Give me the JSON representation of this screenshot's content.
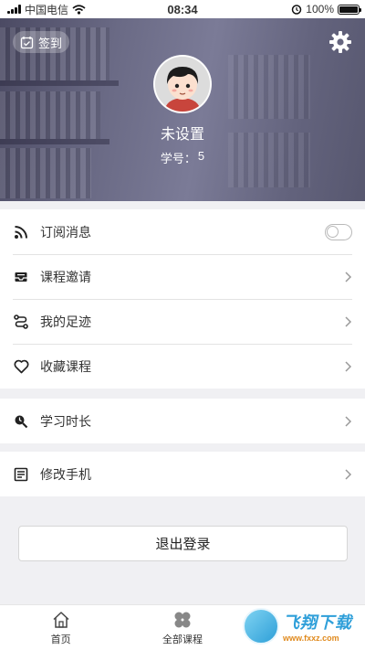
{
  "status_bar": {
    "carrier": "中国电信",
    "time": "08:34",
    "battery": "100%",
    "battery_level": 1.0
  },
  "header": {
    "checkin_label": "签到",
    "username": "未设置",
    "student_id_label": "学号：",
    "student_id_value": "5"
  },
  "menu": {
    "group1": [
      {
        "label": "订阅消息",
        "icon": "rss-icon",
        "control": "toggle",
        "toggle_on": false
      },
      {
        "label": "课程邀请",
        "icon": "inbox-icon",
        "control": "chevron"
      },
      {
        "label": "我的足迹",
        "icon": "route-icon",
        "control": "chevron"
      },
      {
        "label": "收藏课程",
        "icon": "heart-icon",
        "control": "chevron"
      }
    ],
    "group2": [
      {
        "label": "学习时长",
        "icon": "search-clock-icon",
        "control": "chevron"
      }
    ],
    "group3": [
      {
        "label": "修改手机",
        "icon": "form-icon",
        "control": "chevron"
      }
    ]
  },
  "logout_label": "退出登录",
  "tabbar": {
    "tabs": [
      {
        "label": "首页",
        "icon": "home-icon"
      },
      {
        "label": "全部课程",
        "icon": "clover-icon"
      }
    ]
  },
  "watermark": {
    "big": "飞翔下载",
    "small": "www.fxxz.com"
  },
  "colors": {
    "header": "#6a6a85",
    "background": "#f0f0f3",
    "watermark": "#2f9fd9"
  }
}
